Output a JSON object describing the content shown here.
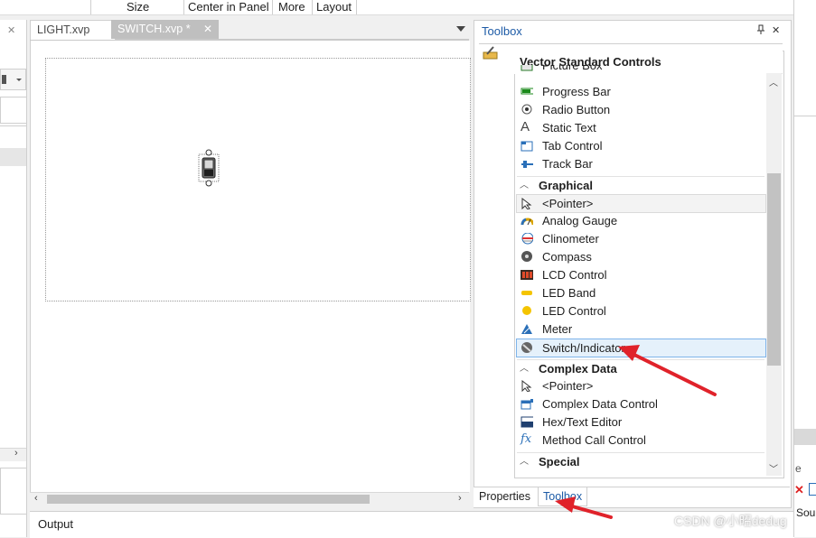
{
  "ribbon": {
    "size": "Size",
    "center": "Center in Panel",
    "more": "More",
    "layout": "Layout"
  },
  "tabs": [
    {
      "label": "LIGHT.xvp"
    },
    {
      "label": "SWITCH.xvp *",
      "close": "✕"
    }
  ],
  "toolbox": {
    "title": "Toolbox",
    "pin": "🖈",
    "close": "✕",
    "header": "Vector Standard Controls",
    "items_top": [
      {
        "label": "Picture Box",
        "icon": "picture-box-icon"
      },
      {
        "label": "Progress Bar",
        "icon": "progress-bar-icon"
      },
      {
        "label": "Radio Button",
        "icon": "radio-button-icon"
      },
      {
        "label": "Static Text",
        "icon": "static-text-icon"
      },
      {
        "label": "Tab Control",
        "icon": "tab-control-icon"
      },
      {
        "label": "Track Bar",
        "icon": "track-bar-icon"
      }
    ],
    "graphical": {
      "title": "Graphical",
      "items": [
        {
          "label": "<Pointer>",
          "icon": "pointer-icon"
        },
        {
          "label": "Analog Gauge",
          "icon": "analog-gauge-icon"
        },
        {
          "label": "Clinometer",
          "icon": "clinometer-icon"
        },
        {
          "label": "Compass",
          "icon": "compass-icon"
        },
        {
          "label": "LCD Control",
          "icon": "lcd-icon"
        },
        {
          "label": "LED Band",
          "icon": "led-band-icon"
        },
        {
          "label": "LED Control",
          "icon": "led-control-icon"
        },
        {
          "label": "Meter",
          "icon": "meter-icon"
        },
        {
          "label": "Switch/Indicator",
          "icon": "switch-indicator-icon"
        }
      ]
    },
    "complex": {
      "title": "Complex Data",
      "items": [
        {
          "label": "<Pointer>",
          "icon": "pointer-icon"
        },
        {
          "label": "Complex Data Control",
          "icon": "complex-data-icon"
        },
        {
          "label": "Hex/Text Editor",
          "icon": "hex-editor-icon"
        },
        {
          "label": "Method Call Control",
          "icon": "method-call-icon"
        }
      ]
    },
    "special": {
      "title": "Special"
    },
    "bottom_tabs": {
      "properties": "Properties",
      "toolbox": "Toolbox"
    }
  },
  "output": {
    "title": "Output"
  },
  "right_strip": {
    "fragment": "Sou"
  },
  "watermark": "CSDN @小昭dedug",
  "colors": {
    "accent": "#1c5aa6",
    "arrow": "#e0222a",
    "selection": "#e5f1fb"
  }
}
